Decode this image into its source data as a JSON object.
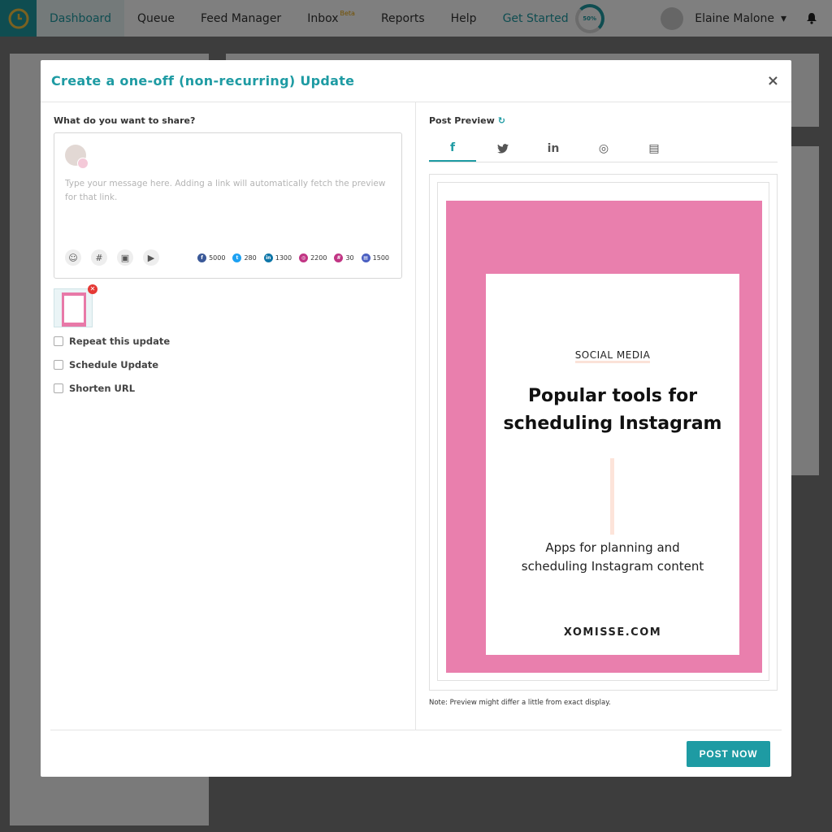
{
  "nav": {
    "items": [
      {
        "label": "Dashboard",
        "active": true
      },
      {
        "label": "Queue"
      },
      {
        "label": "Feed Manager"
      },
      {
        "label": "Inbox",
        "badge": "Beta"
      },
      {
        "label": "Reports"
      },
      {
        "label": "Help"
      },
      {
        "label": "Get Started",
        "teal": true
      }
    ],
    "progress_label": "50%",
    "progress_value": 0.5,
    "user_name": "Elaine Malone"
  },
  "modal": {
    "title": "Create a one-off (non-recurring) Update",
    "close_label": "×",
    "share_label": "What do you want to share?",
    "composer_placeholder": "Type your message here. Adding a link will automatically fetch the preview for that link.",
    "tools": [
      {
        "icon": "emoji-icon",
        "glyph": "☺"
      },
      {
        "icon": "hashtag-icon",
        "glyph": "#"
      },
      {
        "icon": "image-icon",
        "glyph": "▣"
      },
      {
        "icon": "video-icon",
        "glyph": "▶"
      }
    ],
    "counters": [
      {
        "network": "facebook",
        "icon": "facebook-icon",
        "glyph": "f",
        "color": "#3b5998",
        "count": "5000"
      },
      {
        "network": "twitter",
        "icon": "twitter-icon",
        "glyph": "t",
        "color": "#1da1f2",
        "count": "280"
      },
      {
        "network": "linkedin",
        "icon": "linkedin-icon",
        "glyph": "in",
        "color": "#0e76a8",
        "count": "1300"
      },
      {
        "network": "instagram",
        "icon": "instagram-icon",
        "glyph": "◎",
        "color": "#c13584",
        "count": "2200"
      },
      {
        "network": "hashtag",
        "icon": "hashtag-count-icon",
        "glyph": "#",
        "color": "#c13584",
        "count": "30"
      },
      {
        "network": "google-business",
        "icon": "google-business-icon",
        "glyph": "▤",
        "color": "#4a5fc1",
        "count": "1500"
      }
    ],
    "options": [
      {
        "label": "Repeat this update",
        "checked": false
      },
      {
        "label": "Schedule Update",
        "checked": false
      },
      {
        "label": "Shorten URL",
        "checked": false
      }
    ],
    "attachment_remove_glyph": "✕",
    "preview": {
      "label": "Post Preview",
      "refresh_glyph": "↻",
      "tabs": [
        {
          "icon": "facebook-icon",
          "glyph": "f",
          "active": true
        },
        {
          "icon": "twitter-icon",
          "glyph": "🐦"
        },
        {
          "icon": "linkedin-icon",
          "glyph": "in"
        },
        {
          "icon": "instagram-icon",
          "glyph": "◎"
        },
        {
          "icon": "google-business-icon",
          "glyph": "▤"
        }
      ],
      "card": {
        "kicker": "SOCIAL MEDIA",
        "title_line1": "Popular tools for",
        "title_line2": "scheduling Instagram",
        "sub_line1": "Apps for planning and",
        "sub_line2": "scheduling Instagram content",
        "footer": "XOMISSE.COM"
      },
      "note": "Note: Preview might differ a little from exact display."
    },
    "post_button": "POST NOW"
  },
  "colors": {
    "accent": "#1e9ba3",
    "pink": "#e97fad"
  }
}
